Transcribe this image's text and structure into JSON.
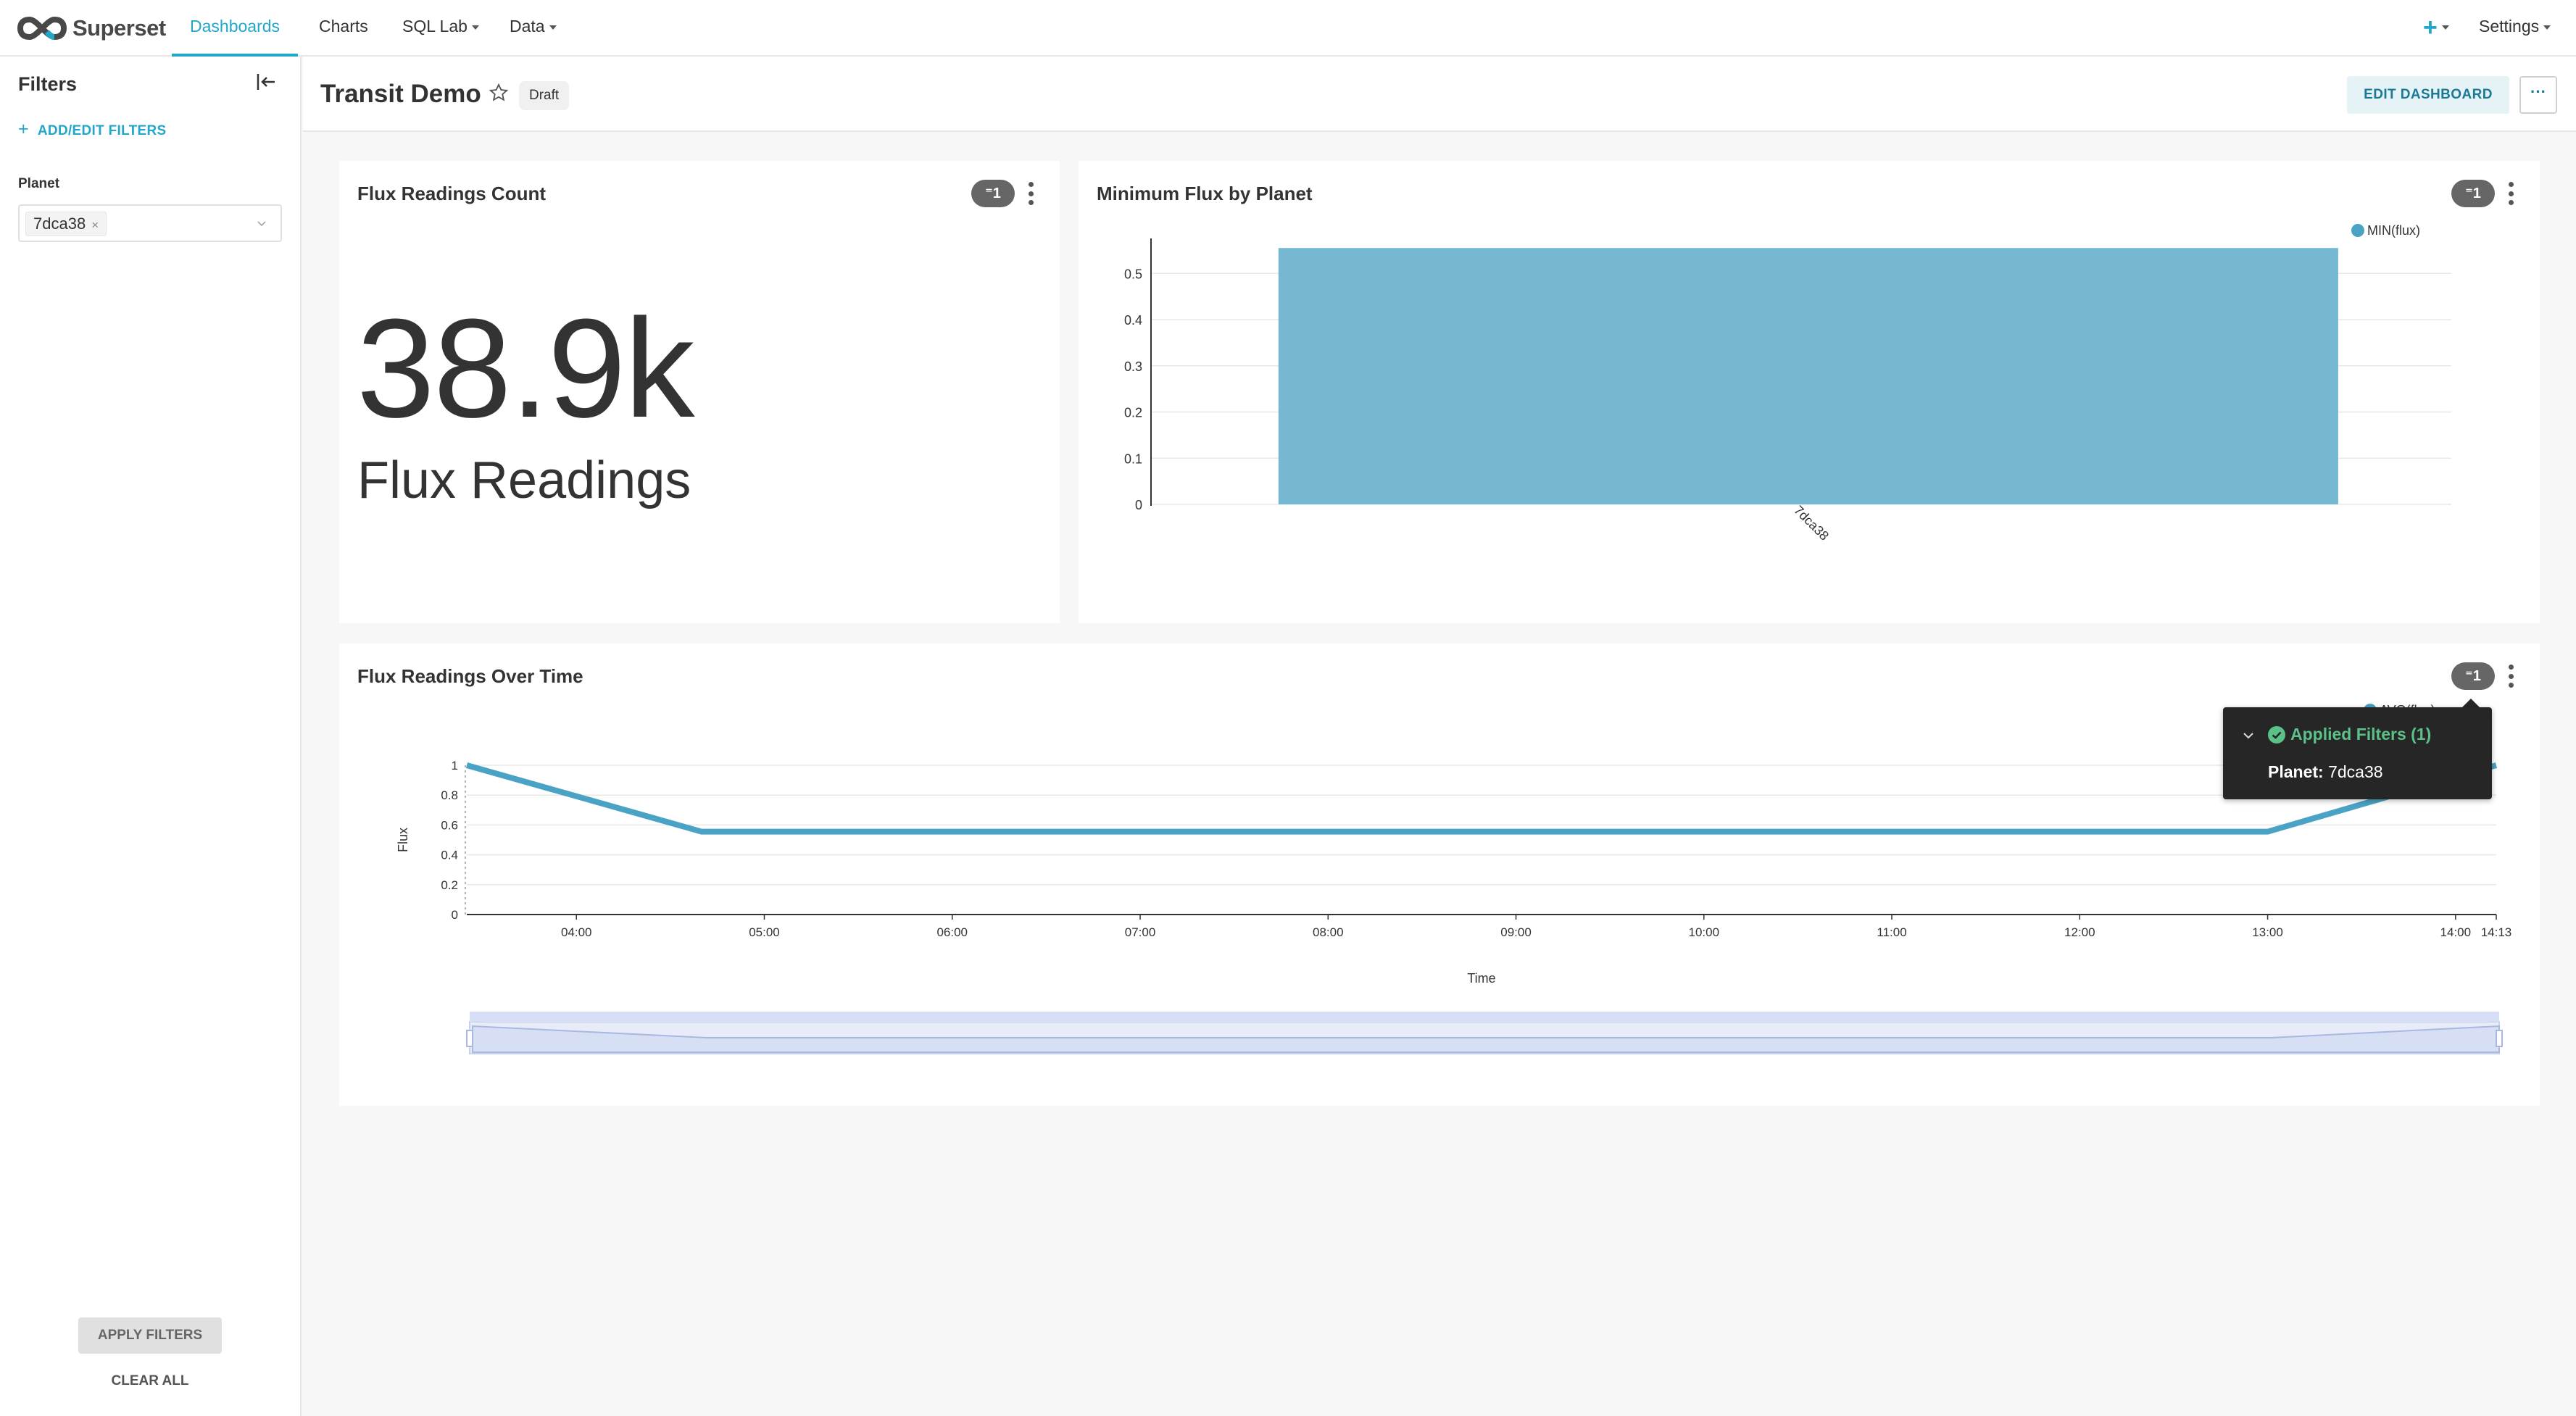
{
  "app": {
    "brand": "Superset",
    "nav": {
      "dashboards": "Dashboards",
      "charts": "Charts",
      "sql_lab": "SQL Lab",
      "data": "Data",
      "settings": "Settings"
    }
  },
  "sidebar": {
    "title": "Filters",
    "add_edit": "ADD/EDIT FILTERS",
    "filter_label": "Planet",
    "filter_value": "7dca38",
    "apply": "APPLY FILTERS",
    "clear": "CLEAR ALL"
  },
  "dashboard": {
    "title": "Transit Demo",
    "status": "Draft",
    "edit_button": "EDIT DASHBOARD",
    "more_button": "···"
  },
  "cards": {
    "count": {
      "title": "Flux Readings Count",
      "filter_count": "1",
      "value": "38.9k",
      "subheader": "Flux Readings"
    },
    "min_flux": {
      "title": "Minimum Flux by Planet",
      "filter_count": "1"
    },
    "over_time": {
      "title": "Flux Readings Over Time",
      "filter_count": "1"
    }
  },
  "tooltip": {
    "title": "Applied Filters (1)",
    "filter_name": "Planet:",
    "filter_value": "7dca38"
  },
  "colors": {
    "accent": "#20a7c9",
    "bar": "#76b8d1",
    "line": "#4aa3c4",
    "success": "#5ac189"
  },
  "chart_data": [
    {
      "type": "bar",
      "categories": [
        "7dca38"
      ],
      "series": [
        {
          "name": "MIN(flux)",
          "values": [
            0.555
          ]
        }
      ],
      "yticks": [
        "0",
        "0.1",
        "0.2",
        "0.3",
        "0.4",
        "0.5"
      ],
      "ylim": [
        0,
        0.56
      ],
      "legend": "top-right",
      "grid": true
    },
    {
      "type": "line",
      "xlabel": "Time",
      "ylabel": "Flux",
      "x": [
        "03:25",
        "04:40",
        "13:00",
        "14:13"
      ],
      "series": [
        {
          "name": "AVG(flux)",
          "values": [
            1,
            0.555,
            0.555,
            1
          ]
        }
      ],
      "xticks": [
        "04:00",
        "05:00",
        "06:00",
        "07:00",
        "08:00",
        "09:00",
        "10:00",
        "11:00",
        "12:00",
        "13:00",
        "14:00",
        "14:13"
      ],
      "yticks": [
        "0",
        "0.2",
        "0.4",
        "0.6",
        "0.8",
        "1"
      ],
      "ylim": [
        0,
        1
      ],
      "legend": "top-right",
      "grid": true
    }
  ]
}
